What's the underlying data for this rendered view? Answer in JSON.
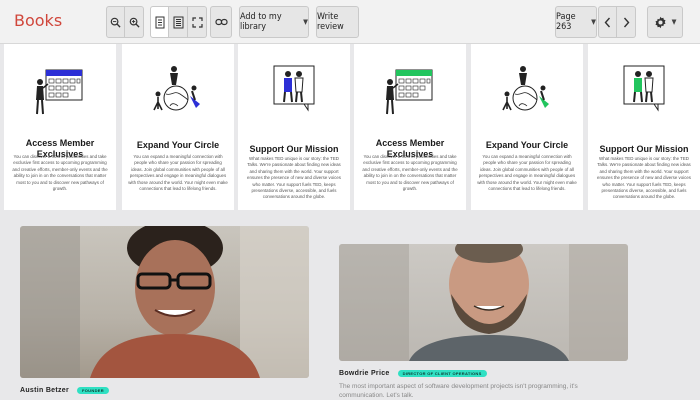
{
  "app": {
    "title": "Books"
  },
  "toolbar": {
    "add_library_label": "Add to my library",
    "write_review_label": "Write review",
    "page_label": "Page 263"
  },
  "cards": [
    {
      "title": "Access Member Exclusives",
      "body": "You can discover a host of possibilities and take exclusive first access to upcoming programming and creative efforts, member-only events and the ability to join in on the conversations that matter most to you and to discover new pathways of growth."
    },
    {
      "title": "Expand Your Circle",
      "body": "You can expand a meaningful connection with people who share your passion for spreading ideas. Join global communities with people of all perspectives and engage in meaningful dialogues with those around the world. Your might even make connections that lead to lifelong friends."
    },
    {
      "title": "Support Our Mission",
      "body": "What makes TED unique is our story: the TED Talks. We're passionate about finding new ideas and sharing them with the world. Your support ensures the presence of new and diverse voices who matter. Your support fuels TED, keeps presentations diverse, accessible, and fuels conversations around the globe."
    },
    {
      "title": "Access Member Exclusives",
      "body": "You can discover a host of possibilities and take exclusive first access to upcoming programming and creative efforts, member-only events and the ability to join in on the conversations that matter most to you and to discover new pathways of growth."
    },
    {
      "title": "Expand Your Circle",
      "body": "You can expand a meaningful connection with people who share your passion for spreading ideas. Join global communities with people of all perspectives and engage in meaningful dialogues with those around the world. Your might even make connections that lead to lifelong friends."
    },
    {
      "title": "Support Our Mission",
      "body": "What makes TED unique is our story: the TED Talks. We're passionate about finding new ideas and sharing them with the world. Your support ensures the presence of new and diverse voices who matter. Your support fuels TED, keeps presentations diverse, accessible, and fuels conversations around the globe."
    }
  ],
  "people": [
    {
      "name": "Austin Betzer",
      "role": "FOUNDER"
    },
    {
      "name": "Bowdrie Price",
      "role": "DIRECTOR OF CLIENT OPERATIONS",
      "quote": "The most important aspect of software development projects isn't programming, it's communication. Let's talk."
    }
  ],
  "colors": {
    "brand": "#d0473c",
    "accent_blue": "#2c2fd6",
    "accent_green": "#22c55e",
    "badge": "#2fe0c3"
  }
}
